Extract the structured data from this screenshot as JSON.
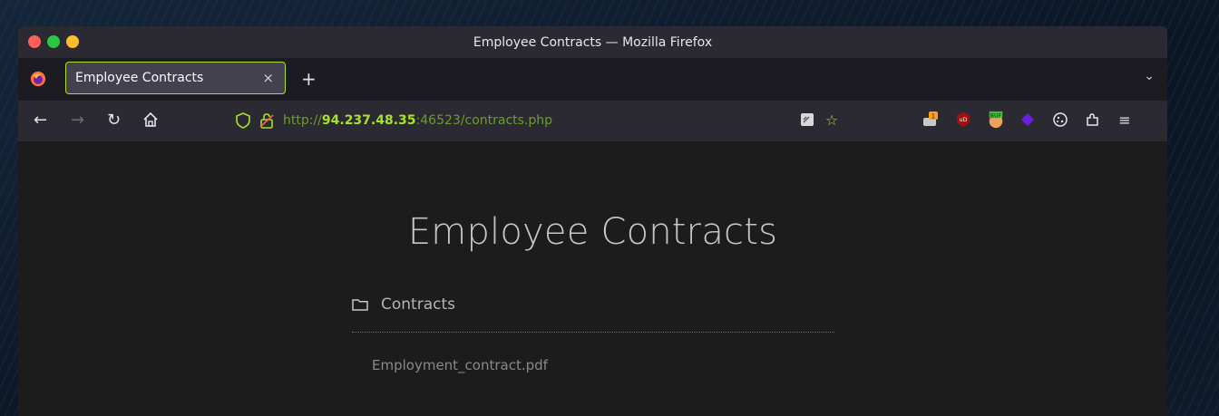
{
  "window": {
    "title": "Employee Contracts — Mozilla Firefox"
  },
  "tabs": [
    {
      "label": "Employee Contracts",
      "close": "×"
    }
  ],
  "newtab": "+",
  "toolbar": {
    "url_scheme": "http://",
    "url_host": "94.237.48.35",
    "url_rest": ":46523/contracts.php",
    "extension_badge": "1",
    "buf_badge": "BUF"
  },
  "page": {
    "title": "Employee Contracts",
    "folder": "Contracts",
    "files": [
      "Employment_contract.pdf"
    ]
  },
  "colors": {
    "accent": "#a8e22b",
    "url_path": "#6c9d2a",
    "page_bg": "#1c1c1c"
  }
}
